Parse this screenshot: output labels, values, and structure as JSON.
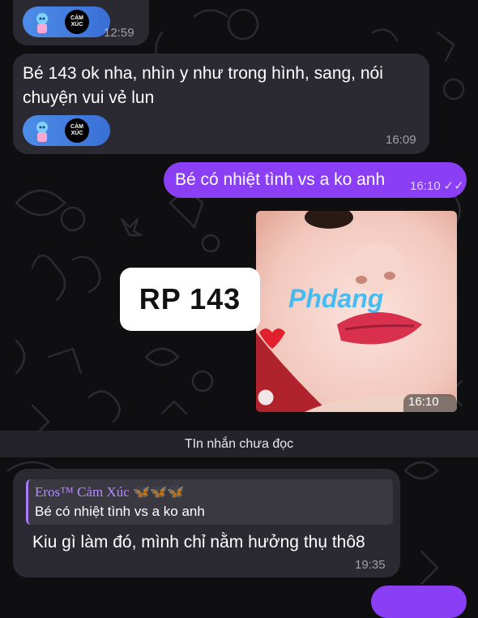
{
  "messages": [
    {
      "id": "m1",
      "time": "12:59",
      "sticker": {
        "logo_line1": "CẢM",
        "logo_line2": "XÚC"
      }
    },
    {
      "id": "m2",
      "text_line1": "Bé 143 ok nha, nhìn y như trong hình, sang, nói",
      "text_line2": "chuyện vui vẻ lun",
      "time": "16:09",
      "sticker": {
        "logo_line1": "CẢM",
        "logo_line2": "XÚC"
      }
    },
    {
      "id": "m3",
      "text": "Bé có nhiệt tình vs a ko anh",
      "time": "16:10"
    },
    {
      "id": "m4",
      "time": "16:10",
      "badge_text": "RP 143",
      "badge_watermark": "Phdang"
    }
  ],
  "unread_label": "TIn nhắn chưa đọc",
  "reply_message": {
    "quoted_name": "Eros™ Cảm Xúc 🦋🦋🦋",
    "quoted_text": "Bé có nhiệt tình vs a ko anh",
    "text": "Kiu gì làm đó, mình chỉ nằm hưởng thụ thô8",
    "time": "19:35"
  },
  "colors": {
    "background": "#0f0f12",
    "incoming_bubble": "#2b2a33",
    "outgoing_bubble": "#8a3ff5",
    "accent_name": "#b48cff"
  }
}
